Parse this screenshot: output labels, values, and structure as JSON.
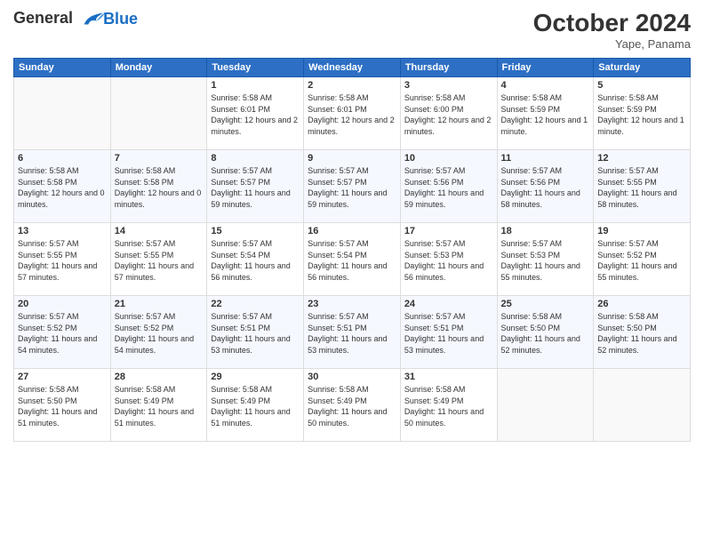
{
  "header": {
    "logo_line1": "General",
    "logo_line2": "Blue",
    "month": "October 2024",
    "location": "Yape, Panama"
  },
  "days_of_week": [
    "Sunday",
    "Monday",
    "Tuesday",
    "Wednesday",
    "Thursday",
    "Friday",
    "Saturday"
  ],
  "weeks": [
    [
      {
        "day": "",
        "info": ""
      },
      {
        "day": "",
        "info": ""
      },
      {
        "day": "1",
        "info": "Sunrise: 5:58 AM\nSunset: 6:01 PM\nDaylight: 12 hours and 2 minutes."
      },
      {
        "day": "2",
        "info": "Sunrise: 5:58 AM\nSunset: 6:01 PM\nDaylight: 12 hours and 2 minutes."
      },
      {
        "day": "3",
        "info": "Sunrise: 5:58 AM\nSunset: 6:00 PM\nDaylight: 12 hours and 2 minutes."
      },
      {
        "day": "4",
        "info": "Sunrise: 5:58 AM\nSunset: 5:59 PM\nDaylight: 12 hours and 1 minute."
      },
      {
        "day": "5",
        "info": "Sunrise: 5:58 AM\nSunset: 5:59 PM\nDaylight: 12 hours and 1 minute."
      }
    ],
    [
      {
        "day": "6",
        "info": "Sunrise: 5:58 AM\nSunset: 5:58 PM\nDaylight: 12 hours and 0 minutes."
      },
      {
        "day": "7",
        "info": "Sunrise: 5:58 AM\nSunset: 5:58 PM\nDaylight: 12 hours and 0 minutes."
      },
      {
        "day": "8",
        "info": "Sunrise: 5:57 AM\nSunset: 5:57 PM\nDaylight: 11 hours and 59 minutes."
      },
      {
        "day": "9",
        "info": "Sunrise: 5:57 AM\nSunset: 5:57 PM\nDaylight: 11 hours and 59 minutes."
      },
      {
        "day": "10",
        "info": "Sunrise: 5:57 AM\nSunset: 5:56 PM\nDaylight: 11 hours and 59 minutes."
      },
      {
        "day": "11",
        "info": "Sunrise: 5:57 AM\nSunset: 5:56 PM\nDaylight: 11 hours and 58 minutes."
      },
      {
        "day": "12",
        "info": "Sunrise: 5:57 AM\nSunset: 5:55 PM\nDaylight: 11 hours and 58 minutes."
      }
    ],
    [
      {
        "day": "13",
        "info": "Sunrise: 5:57 AM\nSunset: 5:55 PM\nDaylight: 11 hours and 57 minutes."
      },
      {
        "day": "14",
        "info": "Sunrise: 5:57 AM\nSunset: 5:55 PM\nDaylight: 11 hours and 57 minutes."
      },
      {
        "day": "15",
        "info": "Sunrise: 5:57 AM\nSunset: 5:54 PM\nDaylight: 11 hours and 56 minutes."
      },
      {
        "day": "16",
        "info": "Sunrise: 5:57 AM\nSunset: 5:54 PM\nDaylight: 11 hours and 56 minutes."
      },
      {
        "day": "17",
        "info": "Sunrise: 5:57 AM\nSunset: 5:53 PM\nDaylight: 11 hours and 56 minutes."
      },
      {
        "day": "18",
        "info": "Sunrise: 5:57 AM\nSunset: 5:53 PM\nDaylight: 11 hours and 55 minutes."
      },
      {
        "day": "19",
        "info": "Sunrise: 5:57 AM\nSunset: 5:52 PM\nDaylight: 11 hours and 55 minutes."
      }
    ],
    [
      {
        "day": "20",
        "info": "Sunrise: 5:57 AM\nSunset: 5:52 PM\nDaylight: 11 hours and 54 minutes."
      },
      {
        "day": "21",
        "info": "Sunrise: 5:57 AM\nSunset: 5:52 PM\nDaylight: 11 hours and 54 minutes."
      },
      {
        "day": "22",
        "info": "Sunrise: 5:57 AM\nSunset: 5:51 PM\nDaylight: 11 hours and 53 minutes."
      },
      {
        "day": "23",
        "info": "Sunrise: 5:57 AM\nSunset: 5:51 PM\nDaylight: 11 hours and 53 minutes."
      },
      {
        "day": "24",
        "info": "Sunrise: 5:57 AM\nSunset: 5:51 PM\nDaylight: 11 hours and 53 minutes."
      },
      {
        "day": "25",
        "info": "Sunrise: 5:58 AM\nSunset: 5:50 PM\nDaylight: 11 hours and 52 minutes."
      },
      {
        "day": "26",
        "info": "Sunrise: 5:58 AM\nSunset: 5:50 PM\nDaylight: 11 hours and 52 minutes."
      }
    ],
    [
      {
        "day": "27",
        "info": "Sunrise: 5:58 AM\nSunset: 5:50 PM\nDaylight: 11 hours and 51 minutes."
      },
      {
        "day": "28",
        "info": "Sunrise: 5:58 AM\nSunset: 5:49 PM\nDaylight: 11 hours and 51 minutes."
      },
      {
        "day": "29",
        "info": "Sunrise: 5:58 AM\nSunset: 5:49 PM\nDaylight: 11 hours and 51 minutes."
      },
      {
        "day": "30",
        "info": "Sunrise: 5:58 AM\nSunset: 5:49 PM\nDaylight: 11 hours and 50 minutes."
      },
      {
        "day": "31",
        "info": "Sunrise: 5:58 AM\nSunset: 5:49 PM\nDaylight: 11 hours and 50 minutes."
      },
      {
        "day": "",
        "info": ""
      },
      {
        "day": "",
        "info": ""
      }
    ]
  ]
}
